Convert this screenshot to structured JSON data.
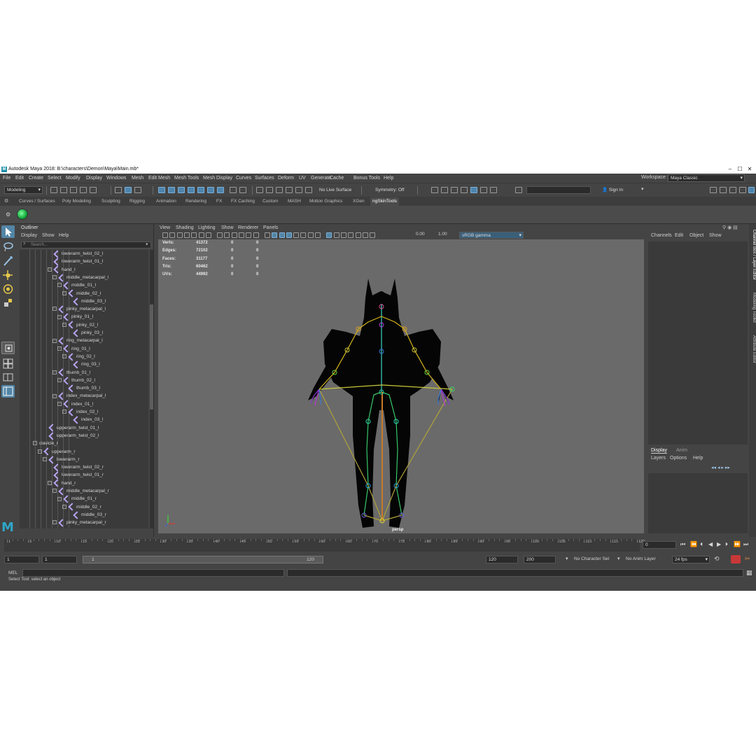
{
  "titlebar": {
    "title": "Autodesk Maya 2018: B:\\characters\\Demon\\Maya\\Main.mb*"
  },
  "menubar": {
    "items": [
      "File",
      "Edit",
      "Create",
      "Select",
      "Modify",
      "Display",
      "Windows",
      "Mesh",
      "Edit Mesh",
      "Mesh Tools",
      "Mesh Display",
      "Curves",
      "Surfaces",
      "Deform",
      "UV",
      "Generate",
      "Cache",
      "Bonus Tools",
      "Help"
    ],
    "workspace_label": "Workspace :",
    "workspace_value": "Maya Classic"
  },
  "statusline": {
    "mode": "Modeling",
    "live_surface": "No Live Surface",
    "symmetry": "Symmetry: Off",
    "sign_in": "Sign In"
  },
  "shelf": {
    "tabs": [
      "Curves / Surfaces",
      "Poly Modeling",
      "Sculpting",
      "Rigging",
      "Animation",
      "Rendering",
      "FX",
      "FX Caching",
      "Custom",
      "MASH",
      "Motion Graphics",
      "XGen",
      "ngSkinTools"
    ],
    "active_tab": "ngSkinTools"
  },
  "outliner": {
    "title": "Outliner",
    "menus": [
      "Display",
      "Show",
      "Help"
    ],
    "search_placeholder": "Search...",
    "rows": [
      {
        "label": "lowerarm_twist_02_l",
        "level": 6,
        "exp": false
      },
      {
        "label": "lowerarm_twist_01_l",
        "level": 6,
        "exp": false
      },
      {
        "label": "hand_l",
        "level": 6,
        "exp": true
      },
      {
        "label": "middle_metacarpal_l",
        "level": 7,
        "exp": true
      },
      {
        "label": "middle_01_l",
        "level": 8,
        "exp": true
      },
      {
        "label": "middle_02_l",
        "level": 9,
        "exp": true
      },
      {
        "label": "middle_03_l",
        "level": 10,
        "exp": false
      },
      {
        "label": "pinky_metacarpal_l",
        "level": 7,
        "exp": true
      },
      {
        "label": "pinky_01_l",
        "level": 8,
        "exp": true
      },
      {
        "label": "pinky_02_l",
        "level": 9,
        "exp": true
      },
      {
        "label": "pinky_03_l",
        "level": 10,
        "exp": false
      },
      {
        "label": "ring_metacarpal_l",
        "level": 7,
        "exp": true
      },
      {
        "label": "ring_01_l",
        "level": 8,
        "exp": true
      },
      {
        "label": "ring_02_l",
        "level": 9,
        "exp": true
      },
      {
        "label": "ring_03_l",
        "level": 10,
        "exp": false
      },
      {
        "label": "thumb_01_l",
        "level": 7,
        "exp": true
      },
      {
        "label": "thumb_02_l",
        "level": 8,
        "exp": true
      },
      {
        "label": "thumb_03_l",
        "level": 9,
        "exp": false
      },
      {
        "label": "index_metacarpal_l",
        "level": 7,
        "exp": true
      },
      {
        "label": "index_01_l",
        "level": 8,
        "exp": true
      },
      {
        "label": "index_02_l",
        "level": 9,
        "exp": true
      },
      {
        "label": "index_03_l",
        "level": 10,
        "exp": false
      },
      {
        "label": "upperarm_twist_01_l",
        "level": 5,
        "exp": false
      },
      {
        "label": "upperarm_twist_02_l",
        "level": 5,
        "exp": false
      },
      {
        "label": "clavicle_r",
        "level": 3,
        "exp": true,
        "nojoint": true
      },
      {
        "label": "upperarm_r",
        "level": 4,
        "exp": true
      },
      {
        "label": "lowerarm_r",
        "level": 5,
        "exp": true
      },
      {
        "label": "lowerarm_twist_02_r",
        "level": 6,
        "exp": false
      },
      {
        "label": "lowerarm_twist_01_r",
        "level": 6,
        "exp": false
      },
      {
        "label": "hand_r",
        "level": 6,
        "exp": true
      },
      {
        "label": "middle_metacarpal_r",
        "level": 7,
        "exp": true
      },
      {
        "label": "middle_01_r",
        "level": 8,
        "exp": true
      },
      {
        "label": "middle_02_r",
        "level": 9,
        "exp": true
      },
      {
        "label": "middle_03_r",
        "level": 10,
        "exp": false
      },
      {
        "label": "pinky_metacarpal_r",
        "level": 7,
        "exp": true
      }
    ]
  },
  "viewport": {
    "menus": [
      "View",
      "Shading",
      "Lighting",
      "Show",
      "Renderer",
      "Panels"
    ],
    "exposure": "0.00",
    "gamma": "1.00",
    "color_space": "sRGB gamma",
    "camera": "persp",
    "hud": [
      {
        "label": "Verts:",
        "v1": "41372",
        "v2": "0",
        "v3": "0"
      },
      {
        "label": "Edges:",
        "v1": "72102",
        "v2": "0",
        "v3": "0"
      },
      {
        "label": "Faces:",
        "v1": "31177",
        "v2": "0",
        "v3": "0"
      },
      {
        "label": "Tris:",
        "v1": "60462",
        "v2": "0",
        "v3": "0"
      },
      {
        "label": "UVs:",
        "v1": "44992",
        "v2": "0",
        "v3": "0"
      }
    ]
  },
  "channelbox": {
    "menus": [
      "Channels",
      "Edit",
      "Object",
      "Show"
    ]
  },
  "layers": {
    "tabs": [
      "Display",
      "Anim"
    ],
    "menus": [
      "Layers",
      "Options",
      "Help"
    ]
  },
  "sidetabs": [
    "Channel Box / Layer Editor",
    "Modeling Toolkit",
    "Attribute Editor"
  ],
  "timeline": {
    "ticks": [
      "1",
      "5",
      "10",
      "15",
      "20",
      "25",
      "30",
      "35",
      "40",
      "45",
      "50",
      "55",
      "60",
      "65",
      "70",
      "75",
      "80",
      "85",
      "90",
      "95",
      "100",
      "105",
      "110",
      "115",
      "120"
    ],
    "current_frame": "0"
  },
  "range": {
    "start": "1",
    "start2": "1",
    "slider_start": "1",
    "slider_end": "120",
    "end": "120",
    "end2": "200",
    "char_set": "No Character Set",
    "anim_layer": "No Anim Layer",
    "fps": "24 fps"
  },
  "cmdline": {
    "label": "MEL"
  },
  "helpline": {
    "text": "Select Tool: select an object"
  },
  "colors": {
    "accent": "#5285a6",
    "panel": "#444444",
    "viewport": "#6a6a6a"
  }
}
